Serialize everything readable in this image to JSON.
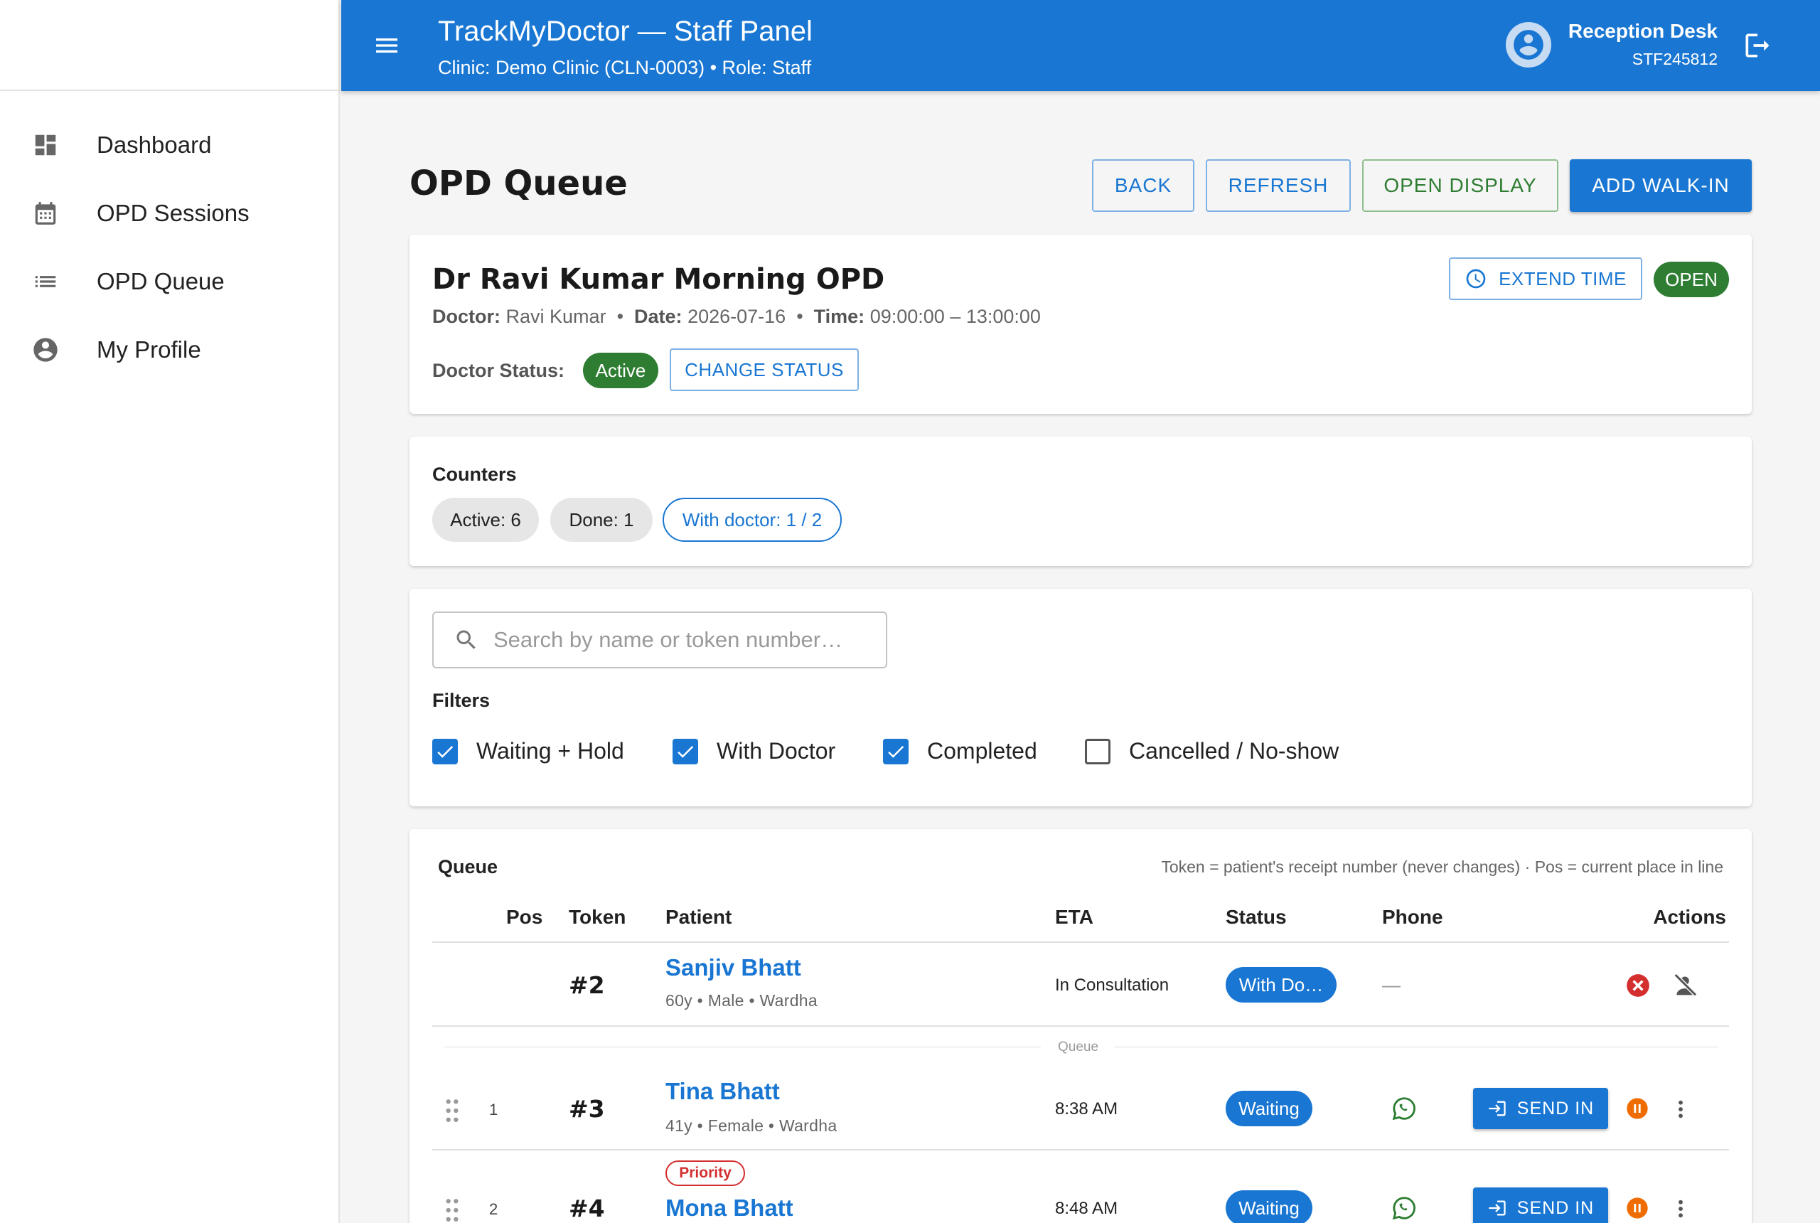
{
  "sidebar": {
    "items": [
      {
        "label": "Dashboard",
        "icon": "dashboard-icon"
      },
      {
        "label": "OPD Sessions",
        "icon": "calendar-icon"
      },
      {
        "label": "OPD Queue",
        "icon": "list-icon"
      },
      {
        "label": "My Profile",
        "icon": "account-circle-icon"
      }
    ]
  },
  "header": {
    "title": "TrackMyDoctor — Staff Panel",
    "subtitle": "Clinic: Demo Clinic (CLN-0003) • Role: Staff",
    "user_name": "Reception Desk",
    "user_id": "STF245812"
  },
  "page": {
    "title": "OPD Queue",
    "buttons": {
      "back": "BACK",
      "refresh": "REFRESH",
      "open_display": "OPEN DISPLAY",
      "add_walkin": "ADD WALK-IN"
    }
  },
  "session": {
    "title": "Dr Ravi Kumar Morning OPD",
    "doctor_label": "Doctor:",
    "doctor": "Ravi Kumar",
    "date_label": "Date:",
    "date": "2026-07-16",
    "time_label": "Time:",
    "time": "09:00:00 – 13:00:00",
    "extend_time": "EXTEND TIME",
    "state": "OPEN",
    "doctor_status_label": "Doctor Status:",
    "doctor_status": "Active",
    "change_status": "CHANGE STATUS"
  },
  "counters": {
    "label": "Counters",
    "active": "Active: 6",
    "done": "Done: 1",
    "with_doctor": "With doctor: 1 / 2"
  },
  "search": {
    "placeholder": "Search by name or token number…"
  },
  "filters": {
    "label": "Filters",
    "items": [
      {
        "label": "Waiting + Hold",
        "checked": true
      },
      {
        "label": "With Doctor",
        "checked": true
      },
      {
        "label": "Completed",
        "checked": true
      },
      {
        "label": "Cancelled / No-show",
        "checked": false
      }
    ]
  },
  "queue": {
    "title": "Queue",
    "hint": "Token = patient's receipt number (never changes) · Pos = current place in line",
    "divider": "Queue",
    "columns": {
      "pos": "Pos",
      "token": "Token",
      "patient": "Patient",
      "eta": "ETA",
      "status": "Status",
      "phone": "Phone",
      "actions": "Actions"
    },
    "current": {
      "token": "#2",
      "name": "Sanjiv Bhatt",
      "info": "60y • Male • Wardha",
      "eta": "In Consultation",
      "status": "With Do…",
      "phone": "—"
    },
    "rows": [
      {
        "pos": "1",
        "token": "#3",
        "name": "Tina Bhatt",
        "info": "41y • Female • Wardha",
        "eta": "8:38 AM",
        "status": "Waiting",
        "action": "SEND IN",
        "priority": ""
      },
      {
        "pos": "2",
        "token": "#4",
        "name": "Mona Bhatt",
        "info": "",
        "eta": "8:48 AM",
        "status": "Waiting",
        "action": "SEND IN",
        "priority": "Priority"
      }
    ]
  },
  "colors": {
    "primary": "#1976d2",
    "success": "#2e7d32",
    "danger": "#d32f2f",
    "hold": "#ef6c00",
    "whatsapp": "#2e7d32"
  }
}
